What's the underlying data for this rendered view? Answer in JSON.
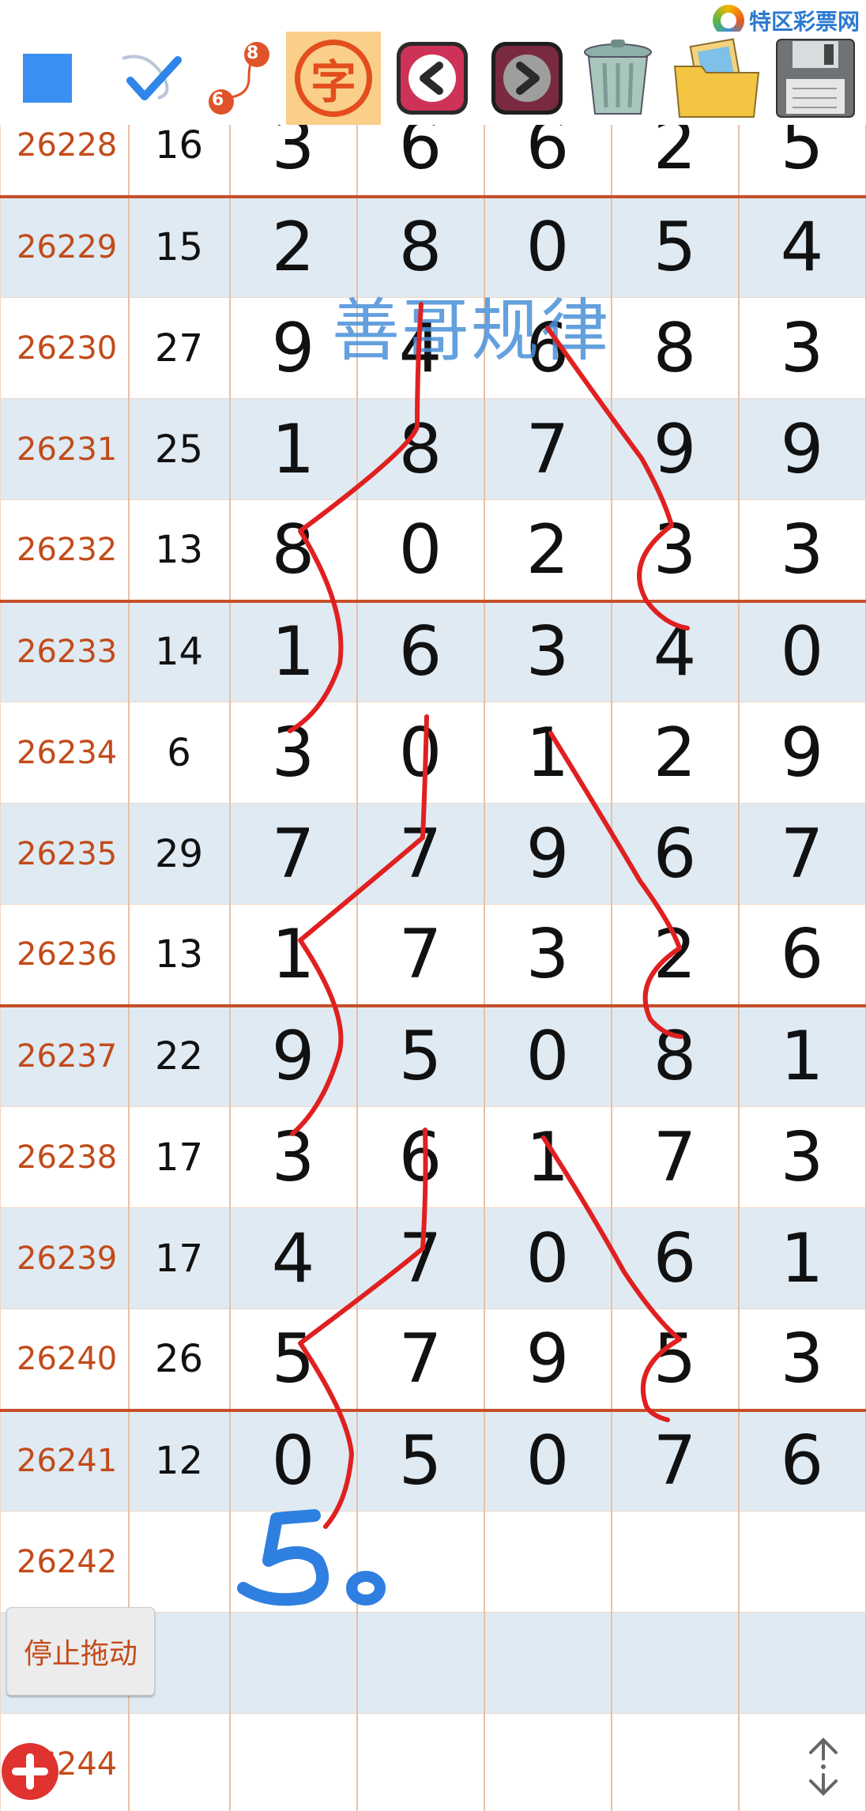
{
  "site": {
    "name": "特区彩票网"
  },
  "toolbar": {
    "badge_top": "8",
    "badge_bottom": "6",
    "char_button": "字"
  },
  "watermark": "善哥规律",
  "rows": [
    {
      "issue": "26228",
      "sum": "16",
      "digits": [
        "3",
        "6",
        "6",
        "2",
        "5"
      ]
    },
    {
      "issue": "26229",
      "sum": "15",
      "digits": [
        "2",
        "8",
        "0",
        "5",
        "4"
      ]
    },
    {
      "issue": "26230",
      "sum": "27",
      "digits": [
        "9",
        "4",
        "6",
        "8",
        "3"
      ]
    },
    {
      "issue": "26231",
      "sum": "25",
      "digits": [
        "1",
        "8",
        "7",
        "9",
        "9"
      ]
    },
    {
      "issue": "26232",
      "sum": "13",
      "digits": [
        "8",
        "0",
        "2",
        "3",
        "3"
      ]
    },
    {
      "issue": "26233",
      "sum": "14",
      "digits": [
        "1",
        "6",
        "3",
        "4",
        "0"
      ]
    },
    {
      "issue": "26234",
      "sum": "6",
      "digits": [
        "3",
        "0",
        "1",
        "2",
        "9"
      ]
    },
    {
      "issue": "26235",
      "sum": "29",
      "digits": [
        "7",
        "7",
        "9",
        "6",
        "7"
      ]
    },
    {
      "issue": "26236",
      "sum": "13",
      "digits": [
        "1",
        "7",
        "3",
        "2",
        "6"
      ]
    },
    {
      "issue": "26237",
      "sum": "22",
      "digits": [
        "9",
        "5",
        "0",
        "8",
        "1"
      ]
    },
    {
      "issue": "26238",
      "sum": "17",
      "digits": [
        "3",
        "6",
        "1",
        "7",
        "3"
      ]
    },
    {
      "issue": "26239",
      "sum": "17",
      "digits": [
        "4",
        "7",
        "0",
        "6",
        "1"
      ]
    },
    {
      "issue": "26240",
      "sum": "26",
      "digits": [
        "5",
        "7",
        "9",
        "5",
        "3"
      ]
    },
    {
      "issue": "26241",
      "sum": "12",
      "digits": [
        "0",
        "5",
        "0",
        "7",
        "6"
      ]
    },
    {
      "issue": "26242",
      "sum": "",
      "digits": [
        "",
        "",
        "",
        "",
        ""
      ]
    },
    {
      "issue": "",
      "sum": "",
      "digits": [
        "",
        "",
        "",
        "",
        ""
      ]
    },
    {
      "issue": "26244",
      "sum": "",
      "digits": [
        "",
        "",
        "",
        "",
        ""
      ]
    }
  ],
  "handwritten_note": "50",
  "stop_drag_label": "停止拖动",
  "colors": {
    "accent_red": "#e0322f",
    "issue_text": "#c24b1a",
    "row_alt": "#dfeaf3",
    "ink_red": "#e02020",
    "ink_blue": "#2f7fe0",
    "separator": "#c74f2a"
  }
}
